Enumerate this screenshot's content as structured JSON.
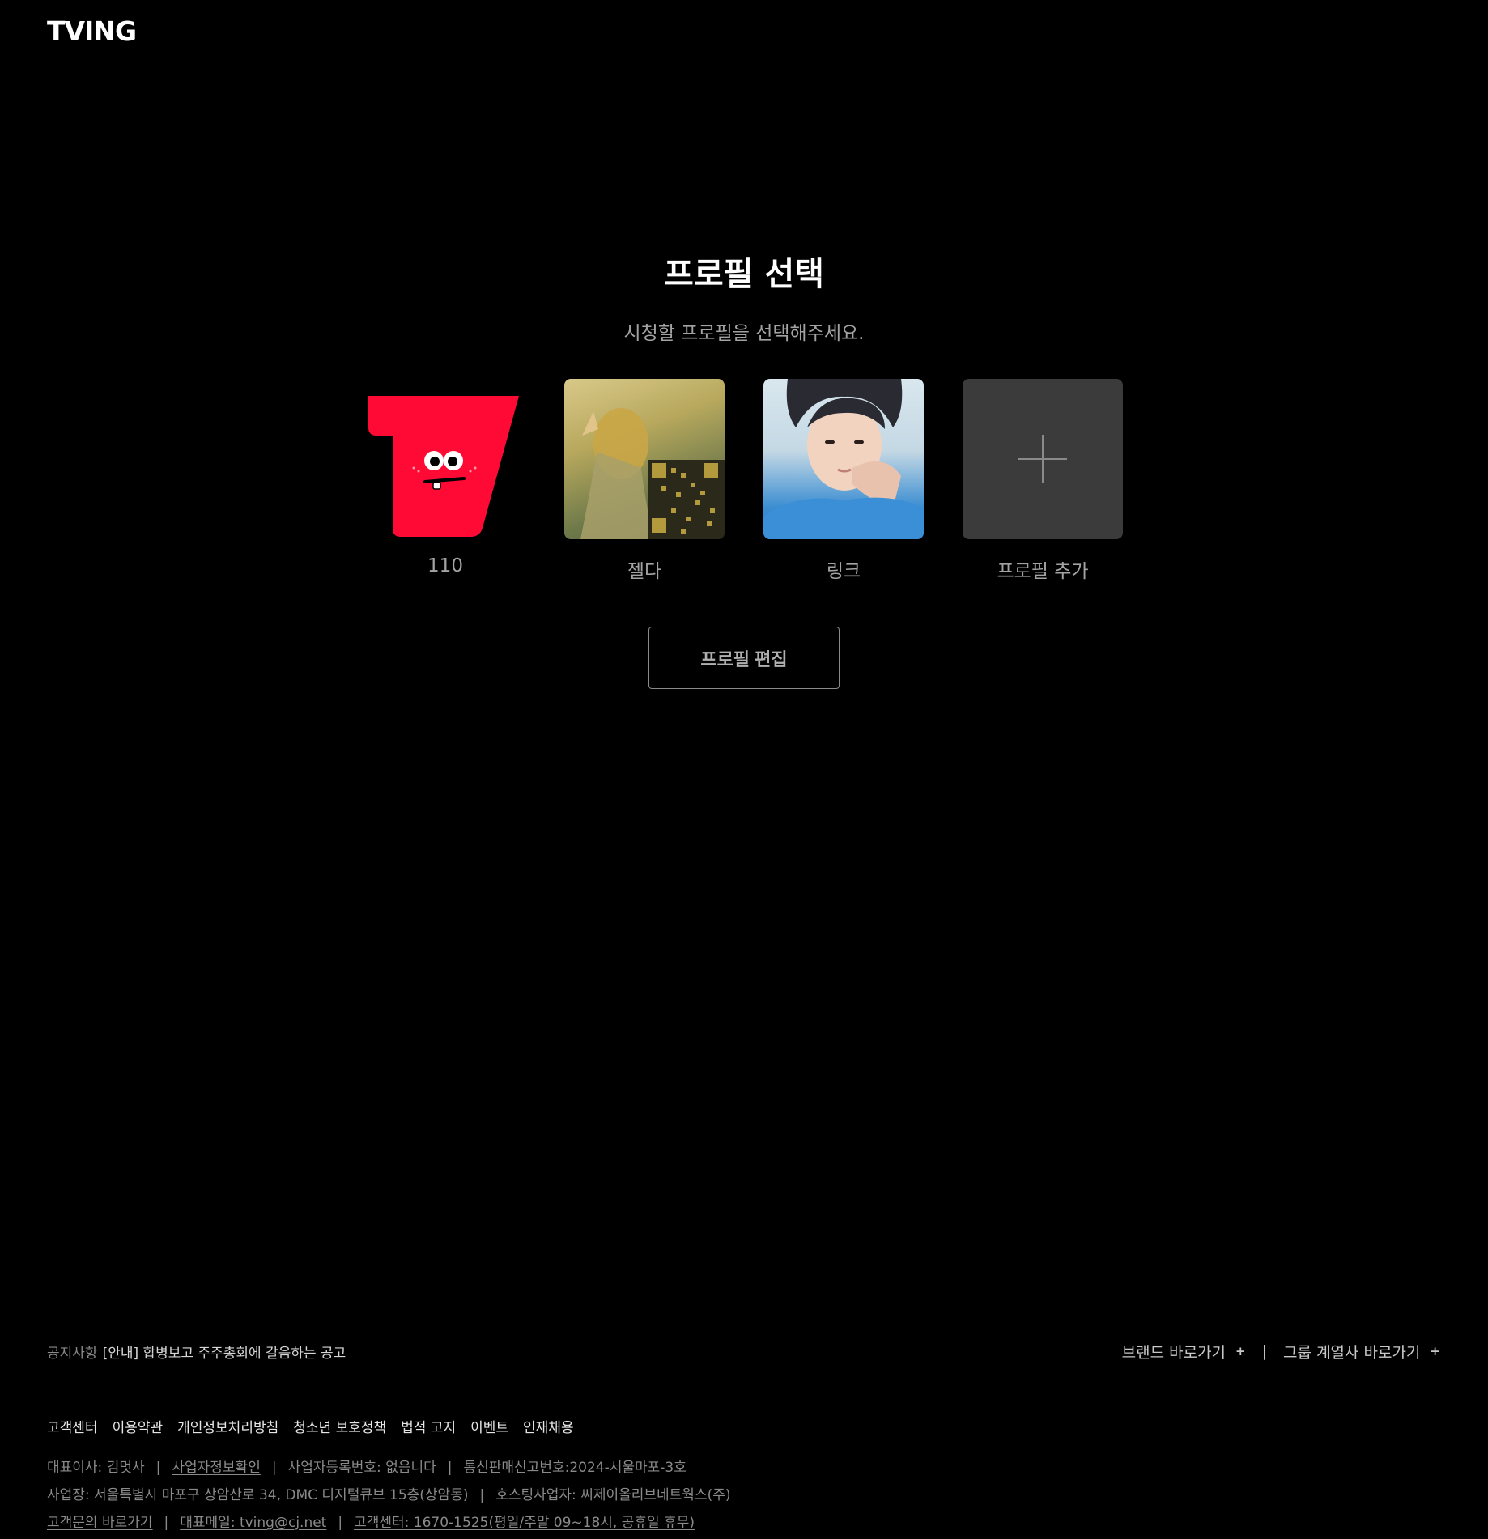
{
  "header": {
    "logo": "TVING"
  },
  "main": {
    "title": "프로필 선택",
    "subtitle": "시청할 프로필을 선택해주세요.",
    "profiles": [
      {
        "name": "110"
      },
      {
        "name": "젤다"
      },
      {
        "name": "링크"
      },
      {
        "name": "프로필 추가"
      }
    ],
    "edit_button": "프로필 편집"
  },
  "footer": {
    "notice_label": "공지사항",
    "notice_text": "[안내] 합병보고 주주총회에 갈음하는 공고",
    "brand_link": "브랜드 바로가기",
    "group_link": "그룹 계열사 바로가기",
    "plus": "+",
    "vsep": "|",
    "links": [
      "고객센터",
      "이용약관",
      "개인정보처리방침",
      "청소년 보호정책",
      "법적 고지",
      "이벤트",
      "인재채용"
    ],
    "sep": "|",
    "ceo": "대표이사: 김멋사",
    "biz_check": "사업자정보확인",
    "biz_reg": "사업자등록번호: 없음니다",
    "ecommerce": "통신판매신고번호:2024-서울마포-3호",
    "address": "사업장: 서울특별시 마포구 상암산로 34, DMC 디지털큐브 15층(상암동)",
    "hosting": "호스팅사업자: 씨제이올리브네트웍스(주)",
    "inquiry": "고객문의 바로가기",
    "email": "대표메일: tving@cj.net",
    "center": "고객센터: 1670-1525(평일/주말 09~18시, 공휴일 휴무)"
  }
}
